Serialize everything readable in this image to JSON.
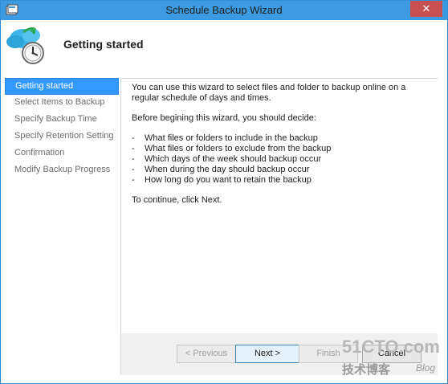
{
  "window": {
    "title": "Schedule Backup Wizard",
    "close_glyph": "✕",
    "accent_color": "#3c9ae0"
  },
  "header": {
    "title": "Getting started",
    "icon": "cloud-clock-icon"
  },
  "steps": [
    {
      "label": "Getting started",
      "active": true
    },
    {
      "label": "Select Items to Backup",
      "active": false
    },
    {
      "label": "Specify Backup Time",
      "active": false
    },
    {
      "label": "Specify Retention Setting",
      "active": false
    },
    {
      "label": "Confirmation",
      "active": false
    },
    {
      "label": "Modify Backup Progress",
      "active": false
    }
  ],
  "main": {
    "intro": "You can use this wizard to select files and folder to backup online on a regular schedule of days and times.",
    "decide_heading": "Before begining this wizard, you should decide:",
    "bullets": [
      "What files or folders to include in the backup",
      "What files or folders to exclude from the backup",
      "Which days of the week should backup occur",
      "When during the day should backup occur",
      "How long do you want to retain the backup"
    ],
    "continue_text": "To continue, click Next."
  },
  "buttons": {
    "back_label": "< Previous",
    "next_label": "Next >",
    "finish_label": "Finish",
    "cancel_label": "Cancel"
  },
  "watermark": {
    "main": "51CTO.com",
    "sub": "技术博客",
    "blog": "Blog"
  }
}
